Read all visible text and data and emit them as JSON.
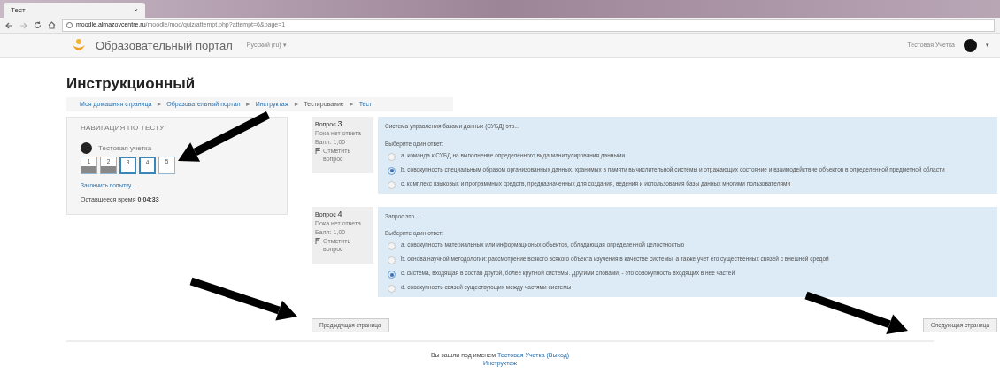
{
  "browser": {
    "tab": {
      "title": "Тест",
      "close": "×"
    },
    "url_host": "moodle.almazovcentre.ru",
    "url_path": "/moodle/mod/quiz/attempt.php?attempt=6&page=1"
  },
  "navbar": {
    "site_name": "Образовательный портал",
    "language": "Русский (ru) ▾",
    "user": "Тестовая Учетка",
    "menu_caret": "▾"
  },
  "page_title": "Инструкционный",
  "breadcrumb": [
    {
      "label": "Моя домашняя страница",
      "link": true
    },
    {
      "label": "Образовательный портал",
      "link": true
    },
    {
      "label": "Инструктаж",
      "link": true
    },
    {
      "label": "Тестирование",
      "link": false
    },
    {
      "label": "Тест",
      "link": true
    }
  ],
  "breadcrumb_separator": "►",
  "quiz_nav": {
    "title": "НАВИГАЦИЯ ПО ТЕСТУ",
    "user": "Тестовая учетка",
    "buttons": [
      {
        "label": "1",
        "answered": true,
        "current": false
      },
      {
        "label": "2",
        "answered": true,
        "current": false
      },
      {
        "label": "3",
        "answered": false,
        "current": true
      },
      {
        "label": "4",
        "answered": false,
        "current": true
      },
      {
        "label": "5",
        "answered": false,
        "current": false
      }
    ],
    "finish_link": "Закончить попытку...",
    "time_label": "Оставшееся время",
    "time_value": "0:04:33"
  },
  "questions": [
    {
      "label": "Вопрос",
      "number": "3",
      "status": "Пока нет ответа",
      "mark": "Балл: 1,00",
      "flag": "Отметить вопрос",
      "text": "Система управления базами данных (СУБД) это...",
      "prompt": "Выберите один ответ:",
      "options": [
        {
          "text": "a. команда к СУБД на выполнение определенного вида манипулирования данными",
          "selected": false
        },
        {
          "text": "b. совокупность специальным образом организованных данных, хранимых в памяти вычислительной системы и отражающих состояние и взаимодействие объектов в определенной предметной области",
          "selected": true
        },
        {
          "text": "c. комплекс языковых и программных средств, предназначенных для создания, ведения и использования базы данных многими пользователями",
          "selected": false
        }
      ]
    },
    {
      "label": "Вопрос",
      "number": "4",
      "status": "Пока нет ответа",
      "mark": "Балл: 1,00",
      "flag": "Отметить вопрос",
      "text": "Запрос это...",
      "prompt": "Выберите один ответ:",
      "options": [
        {
          "text": "a. совокупность материальных или информационых объектов, обладающая определенной целостностью",
          "selected": false
        },
        {
          "text": "b. основа научной методологии: рассмотрение всякого всякого объекта изучения в качестве системы, а также учет его существенных связей с внешней средой",
          "selected": false
        },
        {
          "text": "c. система, входящая в состав другой, более крупной системы. Другими словами, - это совокупность входящих в неё частей",
          "selected": true
        },
        {
          "text": "d. совокупность связей существующих между частями системы",
          "selected": false
        }
      ]
    }
  ],
  "prev_button": "Предыдущая страница",
  "next_button": "Следующая страница",
  "footer": {
    "prefix": "Вы зашли под именем",
    "user_link": "Тестовая Учетка (Выход)",
    "course_link": "Инструктаж"
  }
}
